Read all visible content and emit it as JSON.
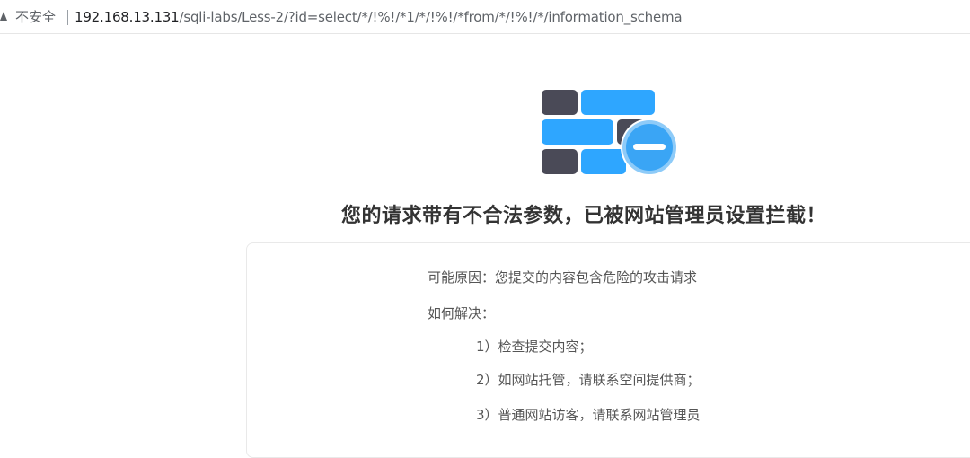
{
  "address_bar": {
    "security_label": "不安全",
    "url_host": "192.168.13.131",
    "url_path": "/sqli-labs/Less-2/?id=select/*/!%!/*1/*/!%!/*from/*/!%!/*/information_schema",
    "warning_icon": "warning-triangle-icon"
  },
  "illustration": {
    "icon": "blocked-firewall-icon",
    "colors": {
      "dark_brick": "#4a4a57",
      "blue_brick": "#2ea6ff",
      "badge_fill": "#3aa5f5",
      "badge_ring": "#8ecbf8",
      "badge_bar": "#ffffff"
    }
  },
  "message": {
    "title": "您的请求带有不合法参数，已被网站管理员设置拦截！",
    "possible_reason": "可能原因：您提交的内容包含危险的攻击请求",
    "how_to_solve": "如何解决：",
    "steps": [
      "1）检查提交内容；",
      "2）如网站托管，请联系空间提供商；",
      "3）普通网站访客，请联系网站管理员"
    ]
  }
}
